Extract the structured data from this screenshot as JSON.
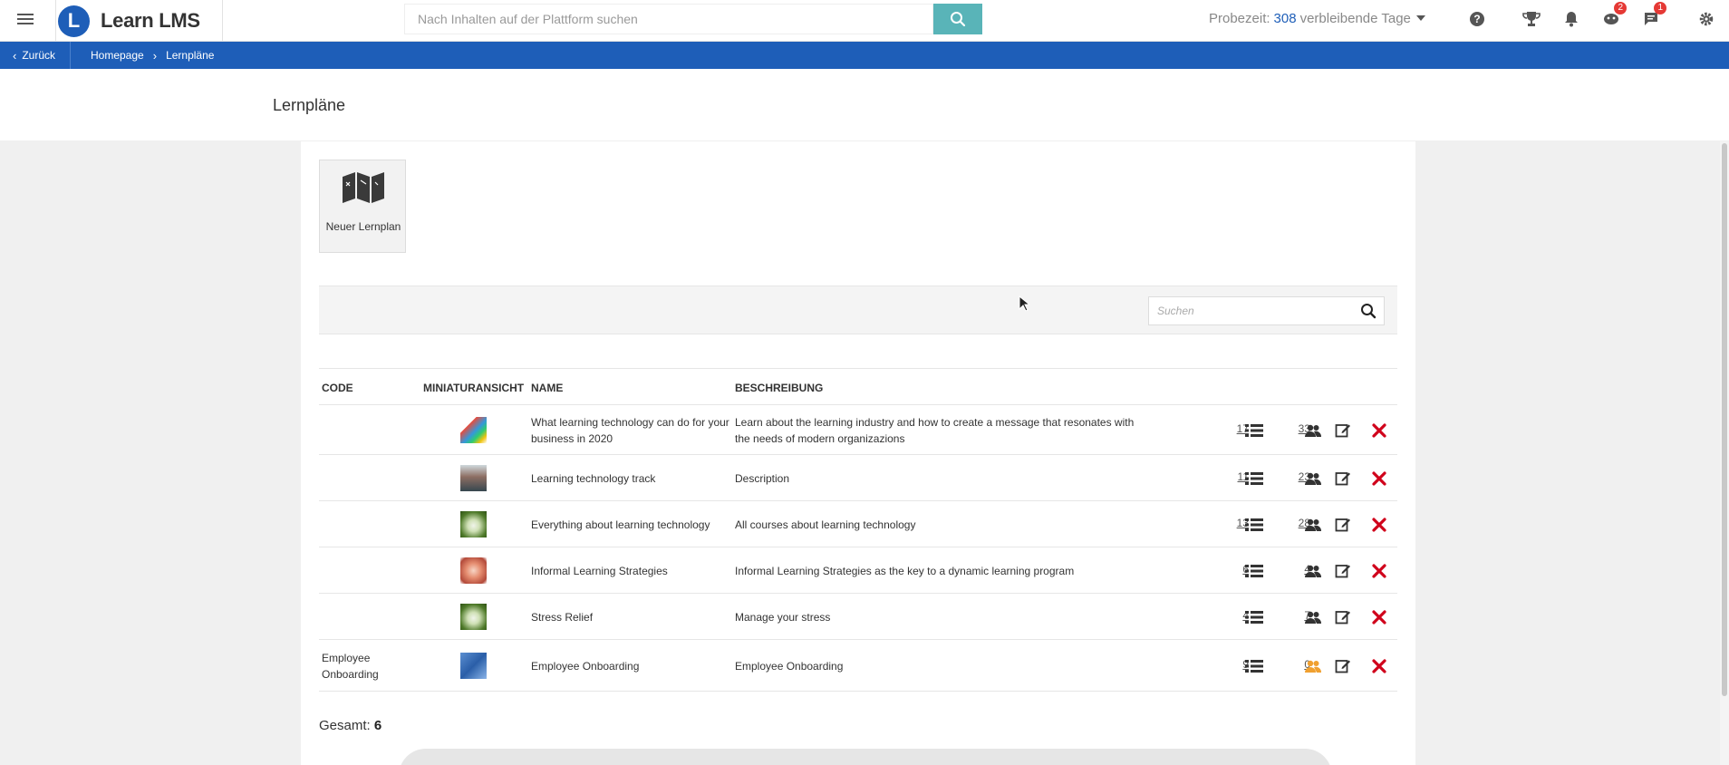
{
  "app": {
    "name": "Learn LMS",
    "logo_letter": "L"
  },
  "topbar": {
    "search_placeholder": "Nach Inhalten auf der Plattform suchen",
    "trial_label": "Probezeit:",
    "trial_days": "308",
    "trial_suffix": "verbleibende Tage",
    "badges": {
      "reviews": "2",
      "messages": "1"
    },
    "icons": [
      "menu-icon",
      "search-icon",
      "help-icon",
      "trophy-icon",
      "bell-icon",
      "review-icon",
      "chat-icon",
      "gear-icon"
    ]
  },
  "breadcrumb": {
    "back_label": "Zurück",
    "items": [
      "Homepage",
      "Lernpläne"
    ]
  },
  "page": {
    "title": "Lernpläne"
  },
  "actions": {
    "new_plan_label": "Neuer Lernplan"
  },
  "filter": {
    "placeholder": "Suchen"
  },
  "table": {
    "headers": {
      "code": "CODE",
      "thumb": "MINIATURANSICHT",
      "name": "NAME",
      "desc": "BESCHREIBUNG"
    },
    "rows": [
      {
        "code": "",
        "name": "What learning technology can do for your business in 2020",
        "desc": "Learn about the learning industry and how to create a message that resonates with the needs of modern organizazions",
        "courses": "17",
        "users": "33"
      },
      {
        "code": "",
        "name": "Learning technology track",
        "desc": "Description",
        "courses": "11",
        "users": "23"
      },
      {
        "code": "",
        "name": "Everything about learning technology",
        "desc": "All courses about learning technology",
        "courses": "13",
        "users": "28"
      },
      {
        "code": "",
        "name": "Informal Learning Strategies",
        "desc": "Informal Learning Strategies as the key to a dynamic learning program",
        "courses": "6",
        "users": "4"
      },
      {
        "code": "",
        "name": "Stress Relief",
        "desc": "Manage your stress",
        "courses": "4",
        "users": "7"
      },
      {
        "code": "Employee Onboarding",
        "name": "Employee Onboarding",
        "desc": "Employee Onboarding",
        "courses": "9",
        "users": "0"
      }
    ]
  },
  "footer": {
    "total_label": "Gesamt:",
    "total_value": "6"
  },
  "colors": {
    "brand": "#1e5eb8",
    "search_button": "#59b4b8",
    "delete": "#d0021b",
    "users_zero": "#f0a030",
    "badge": "#e53935"
  }
}
